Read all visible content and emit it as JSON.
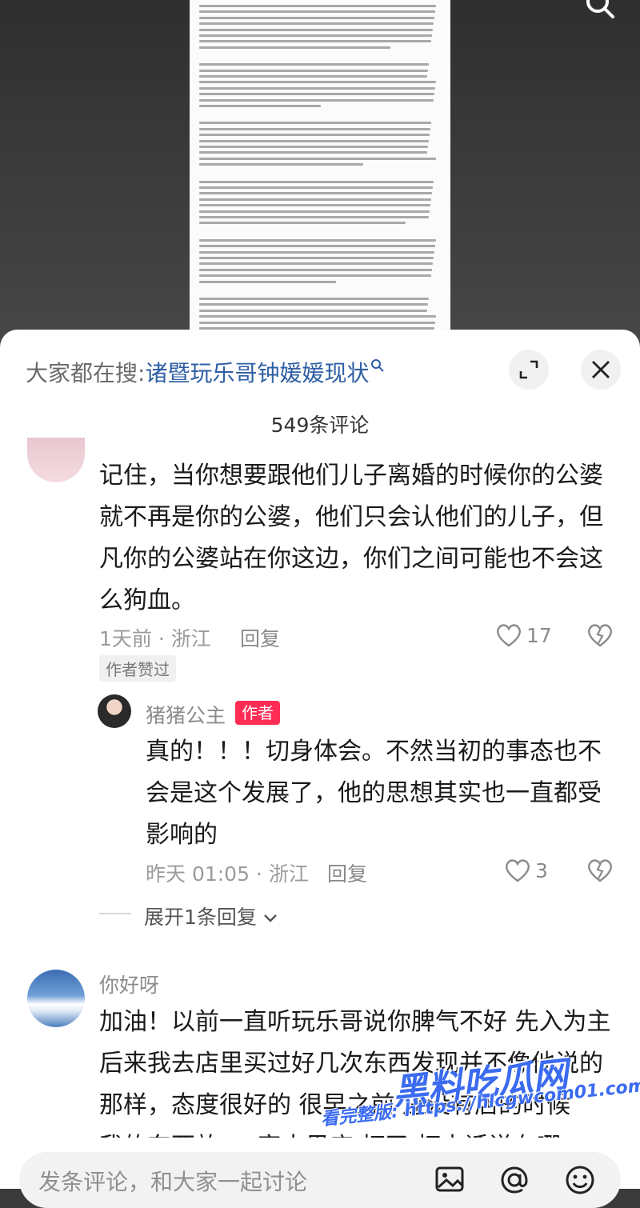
{
  "hot_search": {
    "label": "大家都在搜:",
    "query": "诸暨玩乐哥钟媛媛现状"
  },
  "comment_count": "549条评论",
  "comments": [
    {
      "lines": [
        "记住，当你想要跟他们儿子离婚的时候你的公婆",
        "就不再是你的公婆，他们只会认他们的儿子，但",
        "凡你的公婆站在你这边，你们之间可能也不会这",
        "么狗血。"
      ],
      "meta": "1天前 · 浙江",
      "reply": "回复",
      "likes": "17",
      "author_liked": "作者赞过"
    },
    {
      "name": "猪猪公主",
      "badge": "作者",
      "lines": [
        "真的！！！切身体会。不然当初的事态也不",
        "会是这个发展了，他的思想其实也一直都受",
        "影响的"
      ],
      "meta": "昨天 01:05 · 浙江",
      "reply": "回复",
      "likes": "3"
    },
    {
      "name": "你好呀",
      "lines": [
        "加油！以前一直听玩乐哥说你脾气不好 先入为主",
        "后来我去店里买过好几次东西发现并不像他说的",
        "那样，态度很好的 很早之前 还没有店的时候",
        "我的东西放 ... 家水果店 打了 打电话说在哪"
      ]
    }
  ],
  "expand_replies": "展开1条回复",
  "input_placeholder": "发条评论，和大家一起讨论",
  "watermark": {
    "line1": "黑料吃瓜网",
    "line2": "看完整版: https://hlcgwcom01.com"
  }
}
